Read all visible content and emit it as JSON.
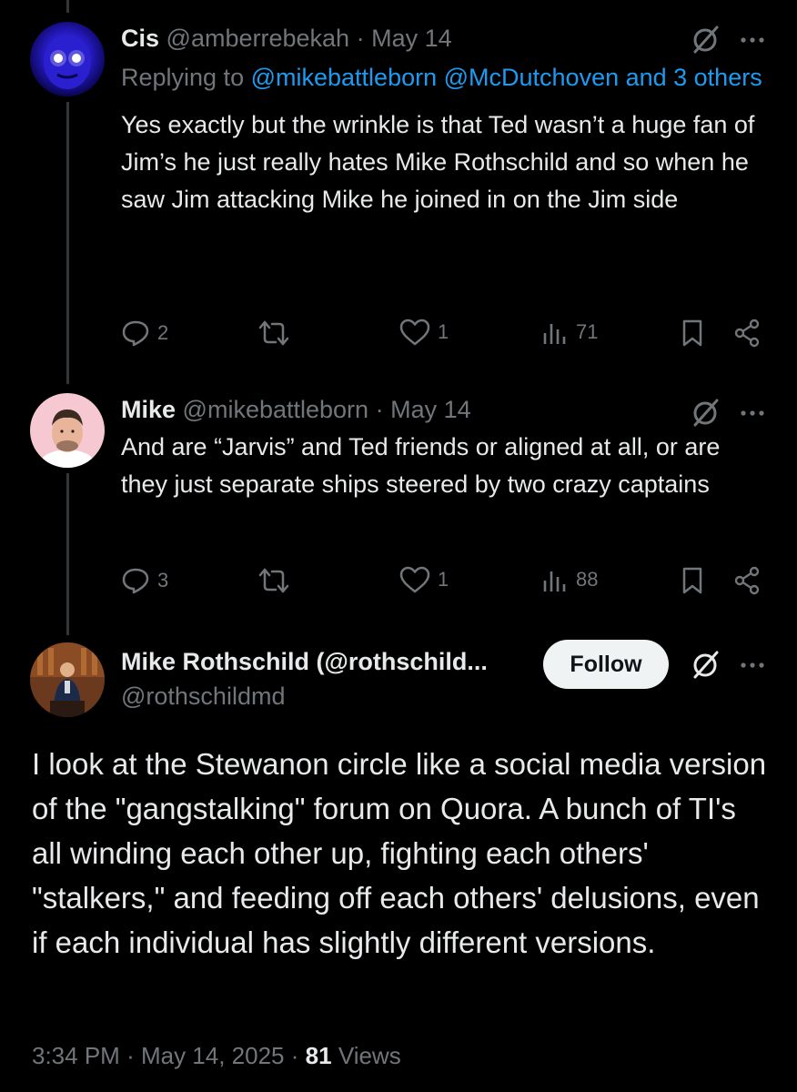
{
  "tweets": [
    {
      "name": "Cis",
      "handle": "@amberrebekah",
      "separator": "·",
      "date": "May 14",
      "replying_prefix": "Replying to",
      "replying_mentions": "@mikebattleborn @McDutchoven and 3 others",
      "body": "Yes exactly but the wrinkle is that Ted wasn’t a huge fan of Jim’s he just really hates Mike Rothschild and so when he saw Jim attacking Mike he joined in on the Jim side",
      "replies": "2",
      "retweets": "",
      "likes": "1",
      "views": "71"
    },
    {
      "name": "Mike",
      "handle": "@mikebattleborn",
      "separator": "·",
      "date": "May 14",
      "body": "And are “Jarvis” and Ted friends or aligned at all, or are they just separate ships steered by two crazy captains",
      "replies": "3",
      "retweets": "",
      "likes": "1",
      "views": "88"
    }
  ],
  "main_tweet": {
    "name": "Mike Rothschild (@rothschild...",
    "handle": "@rothschildmd",
    "follow_label": "Follow",
    "body": "I look at the Stewanon circle like a social media version of the \"gangstalking\" forum on Quora. A bunch of TI's all winding each other up, fighting each others' \"stalkers,\" and feeding off each others' delusions, even if each individual has slightly different versions.",
    "time": "3:34 PM",
    "separator": "·",
    "date": "May 14, 2025",
    "separator2": "·",
    "views_count": "81",
    "views_label": "Views"
  },
  "icons": {
    "more": "more-dots-icon",
    "grok": "grok-icon",
    "reply": "reply-icon",
    "retweet": "retweet-icon",
    "like": "heart-icon",
    "views": "views-icon",
    "bookmark": "bookmark-icon",
    "share": "share-icon"
  },
  "colors": {
    "background": "#000000",
    "text": "#e7e9ea",
    "secondary": "#71767b",
    "link": "#1d9bf0"
  }
}
